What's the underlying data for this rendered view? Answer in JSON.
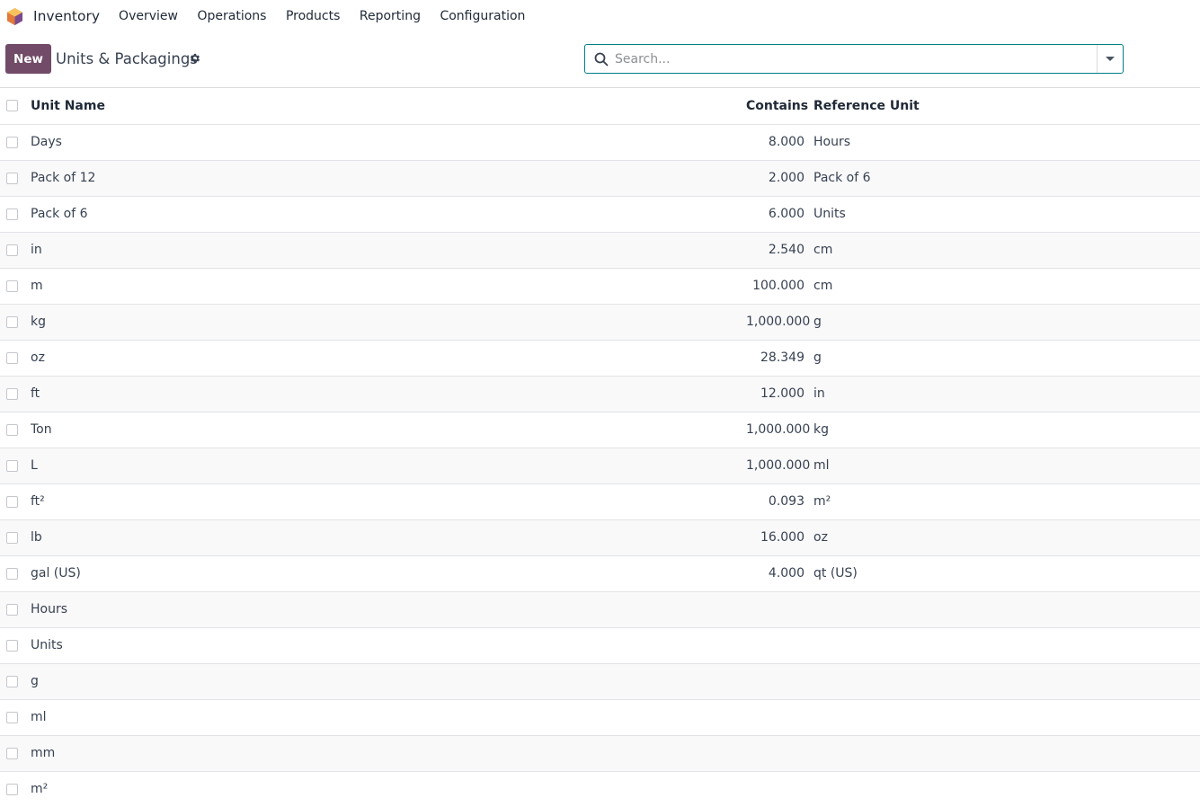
{
  "navbar": {
    "app_name": "Inventory",
    "menu": [
      "Overview",
      "Operations",
      "Products",
      "Reporting",
      "Configuration"
    ]
  },
  "control_panel": {
    "new_label": "New",
    "title": "Units & Packagings",
    "search_placeholder": "Search...",
    "accent_color": "#714b67",
    "focus_color": "#017e84"
  },
  "table": {
    "headers": {
      "name": "Unit Name",
      "contains": "Contains",
      "reference": "Reference Unit"
    },
    "rows": [
      {
        "name": "Days",
        "contains": "8.000",
        "reference": "Hours"
      },
      {
        "name": "Pack of 12",
        "contains": "2.000",
        "reference": "Pack of 6"
      },
      {
        "name": "Pack of 6",
        "contains": "6.000",
        "reference": "Units"
      },
      {
        "name": "in",
        "contains": "2.540",
        "reference": "cm"
      },
      {
        "name": "m",
        "contains": "100.000",
        "reference": "cm"
      },
      {
        "name": "kg",
        "contains": "1,000.000",
        "reference": "g"
      },
      {
        "name": "oz",
        "contains": "28.349",
        "reference": "g"
      },
      {
        "name": "ft",
        "contains": "12.000",
        "reference": "in"
      },
      {
        "name": "Ton",
        "contains": "1,000.000",
        "reference": "kg"
      },
      {
        "name": "L",
        "contains": "1,000.000",
        "reference": "ml"
      },
      {
        "name": "ft²",
        "contains": "0.093",
        "reference": "m²"
      },
      {
        "name": "lb",
        "contains": "16.000",
        "reference": "oz"
      },
      {
        "name": "gal (US)",
        "contains": "4.000",
        "reference": "qt (US)"
      },
      {
        "name": "Hours",
        "contains": "",
        "reference": ""
      },
      {
        "name": "Units",
        "contains": "",
        "reference": ""
      },
      {
        "name": "g",
        "contains": "",
        "reference": ""
      },
      {
        "name": "ml",
        "contains": "",
        "reference": ""
      },
      {
        "name": "mm",
        "contains": "",
        "reference": ""
      },
      {
        "name": "m²",
        "contains": "",
        "reference": ""
      }
    ]
  }
}
